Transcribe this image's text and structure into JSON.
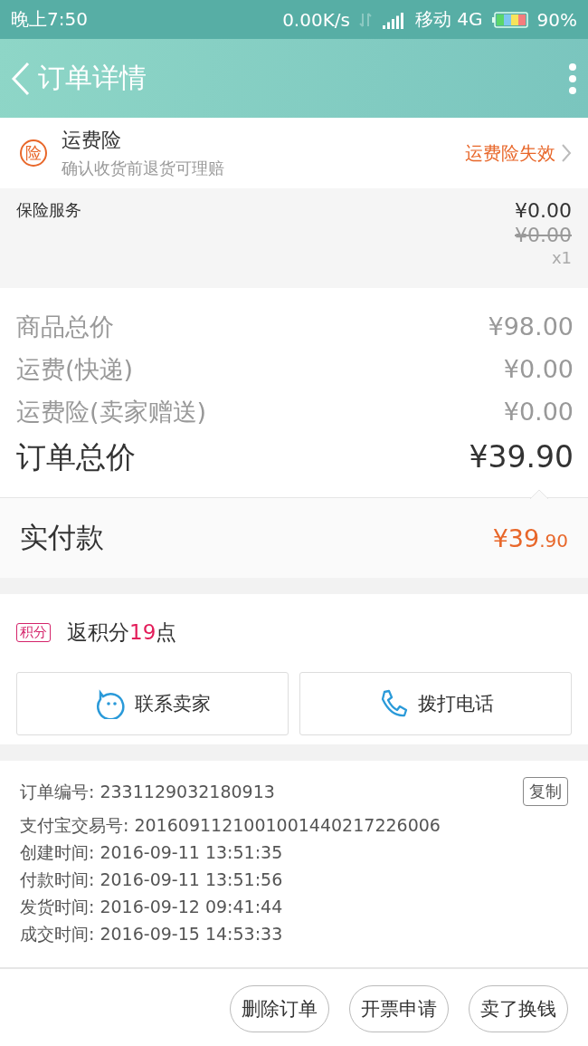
{
  "status_bar": {
    "time": "晚上7:50",
    "speed": "0.00K/s",
    "carrier": "移动 4G",
    "battery": "90%"
  },
  "header": {
    "title": "订单详情"
  },
  "insurance": {
    "badge": "险",
    "title": "运费险",
    "subtitle": "确认收货前退货可理赔",
    "status": "运费险失效"
  },
  "insurance_service": {
    "label": "保险服务",
    "price": "¥0.00",
    "original_price": "¥0.00",
    "quantity": "x1"
  },
  "price_lines": [
    {
      "label": "商品总价",
      "value": "¥98.00",
      "kind": "line"
    },
    {
      "label": "运费(快递)",
      "value": "¥0.00",
      "kind": "line"
    },
    {
      "label": "运费险(卖家赠送)",
      "value": "¥0.00",
      "kind": "line"
    },
    {
      "label": "订单总价",
      "value": "¥39.90",
      "kind": "total"
    }
  ],
  "payment": {
    "label": "实付款",
    "amount": "¥39.90"
  },
  "points": {
    "badge": "积分",
    "text_before": "返积分",
    "points": "19",
    "text_after": "点"
  },
  "contact_buttons": [
    {
      "label": "联系卖家",
      "kind": "chat"
    },
    {
      "label": "拨打电话",
      "kind": "phone"
    }
  ],
  "order_info": {
    "copy_button": "复制",
    "lines": [
      "订单编号: 2331129032180913",
      "支付宝交易号: 2016091121001001440217226006",
      "创建时间: 2016-09-11 13:51:35",
      "付款时间: 2016-09-11 13:51:56",
      "发货时间: 2016-09-12 09:41:44",
      "成交时间: 2016-09-15 14:53:33"
    ]
  },
  "actions": [
    "删除订单",
    "开票申请",
    "卖了换钱"
  ]
}
